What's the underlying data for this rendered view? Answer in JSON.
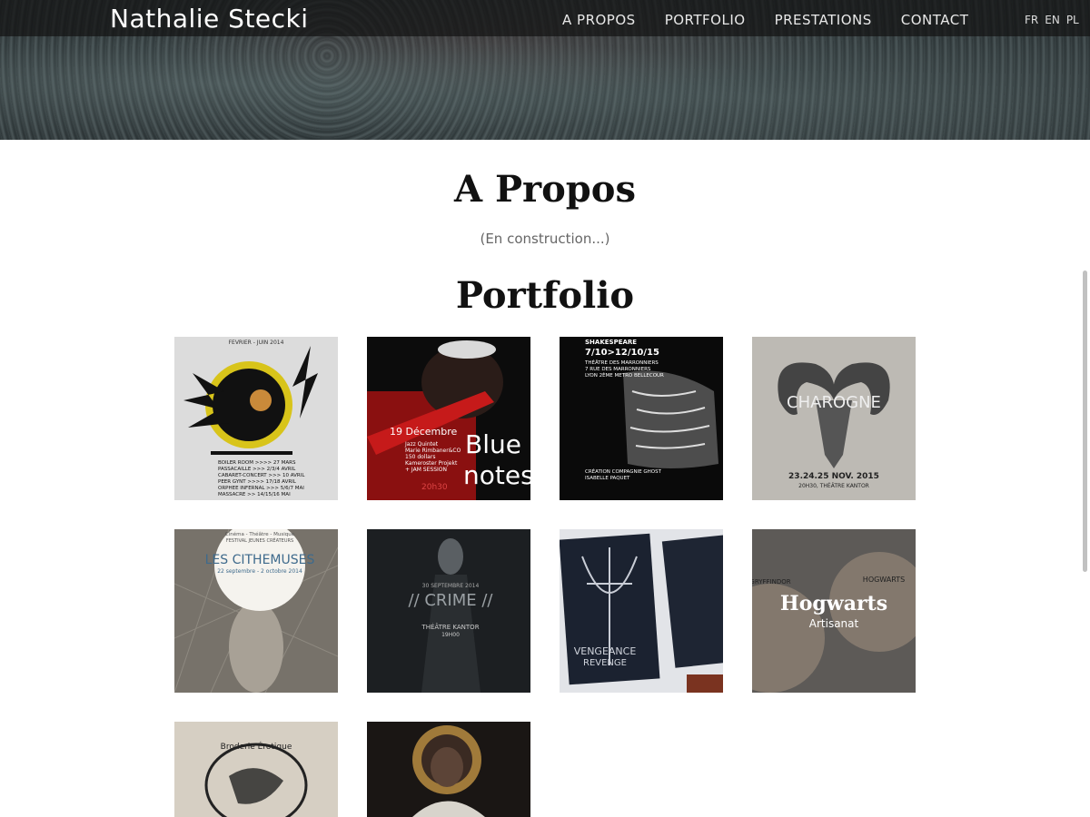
{
  "header": {
    "brand": "Nathalie Stecki",
    "nav": [
      "A PROPOS",
      "PORTFOLIO",
      "PRESTATIONS",
      "CONTACT"
    ],
    "languages": [
      "FR",
      "EN",
      "PL"
    ]
  },
  "about": {
    "title": "A Propos",
    "text": "(En construction...)"
  },
  "portfolio": {
    "title": "Portfolio",
    "tiles": [
      {
        "name": "concert-poster",
        "texts": [
          "FEVRIER - JUIN 2014",
          "BOILER ROOM >>>> 27 MARS",
          "PASSACAILLE >>> 2/3/4 AVRIL",
          "CABARET-CONCERT >>> 10 AVRIL",
          "PEER GYNT >>>> 17/18 AVRIL",
          "ORPHEE INFERNAL >>> 5/6/7 MAI",
          "MASSACRE >> 14/15/16 MAI"
        ]
      },
      {
        "name": "blue-notes",
        "texts": [
          "19 Décembre",
          "Jazz Quintet",
          "Marie Rimbaner&CO",
          "150 dollars",
          "Kameroster Projekt",
          "+ JAM SESSION",
          "Blue",
          "notes",
          "20h30"
        ]
      },
      {
        "name": "shakespeare",
        "texts": [
          "SHAKESPEARE",
          "7/10>12/10/15",
          "THÉÂTRE DES MARRONNIERS",
          "7 RUE DES MARRONNIERS",
          "LYON 2ÈME METRO BELLECOUR",
          "CRÉATION COMPAGNIE GHOST",
          "ISABELLE PAQUET"
        ]
      },
      {
        "name": "charogne",
        "texts": [
          "CHAROGNE",
          "23.24.25 NOV. 2015",
          "20H30, THÉÂTRE KANTOR"
        ]
      },
      {
        "name": "les-cithemuses",
        "texts": [
          "Cinéma - Théâtre - Musique",
          "FESTIVAL JEUNES CRÉATEURS",
          "LES CITHEMUSES",
          "22 septembre - 2 octobre 2014"
        ]
      },
      {
        "name": "crime",
        "texts": [
          "30 SEPTEMBRE 2014",
          "// CRIME //",
          "THÉÂTRE KANTOR",
          "19H00"
        ]
      },
      {
        "name": "vengeance",
        "texts": [
          "VENGEANCE",
          "REVENGE"
        ]
      },
      {
        "name": "hogwarts",
        "title": "Hogwarts",
        "category": "Artisanat",
        "texts": [
          "HOGWARTS",
          "GRYFFINDOR"
        ]
      },
      {
        "name": "broderie",
        "texts": [
          "Broderie Érotique"
        ]
      },
      {
        "name": "portrait",
        "texts": []
      }
    ]
  },
  "colors": {
    "nav_bg": "#141414",
    "heading": "#111111",
    "muted": "#666666"
  }
}
